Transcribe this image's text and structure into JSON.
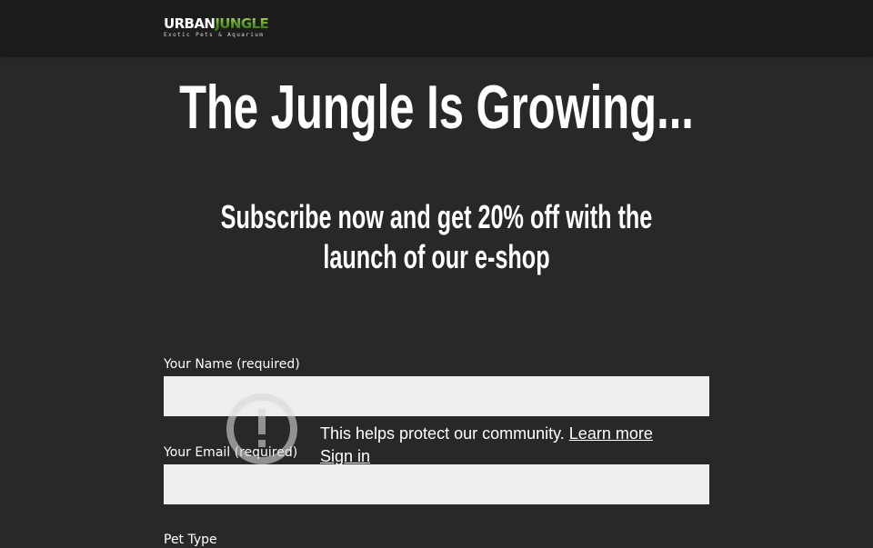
{
  "header": {
    "logo": {
      "word1": "URBAN",
      "word2": "JUNGLE",
      "tagline": "Exotic Pets & Aquarium"
    }
  },
  "hero": {
    "headline": "The Jungle Is Growing...",
    "subhead_line1": "Subscribe now and get 20% off with the",
    "subhead_line2": "launch of our e-shop"
  },
  "form": {
    "name_label": "Your Name (required)",
    "name_value": "",
    "email_label": "Your Email (required)",
    "email_value": "",
    "pet_type_label": "Pet Type"
  },
  "captcha_overlay": {
    "message": "This helps protect our community.",
    "learn_more": "Learn more",
    "sign_in": "Sign in"
  },
  "colors": {
    "background": "#282828",
    "header_bg": "#1c1c1c",
    "input_bg": "#eeeeee",
    "brand_green": "#6fae2f"
  }
}
